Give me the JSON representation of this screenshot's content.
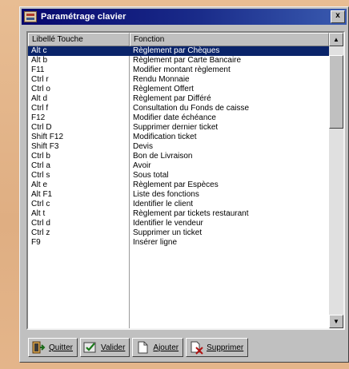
{
  "window": {
    "title": "Paramétrage clavier",
    "close_label": "x"
  },
  "list": {
    "columns": [
      "Libellé Touche",
      "Fonction"
    ],
    "selected_index": 0,
    "rows": [
      {
        "key": "Alt c",
        "function": "Règlement par Chèques"
      },
      {
        "key": "Alt b",
        "function": "Règlement par Carte Bancaire"
      },
      {
        "key": "F11",
        "function": "Modifier montant règlement"
      },
      {
        "key": "Ctrl r",
        "function": "Rendu Monnaie"
      },
      {
        "key": "Ctrl o",
        "function": "Règlement Offert"
      },
      {
        "key": "Alt d",
        "function": "Règlement par Différé"
      },
      {
        "key": "Ctrl f",
        "function": "Consultation du Fonds de caisse"
      },
      {
        "key": "F12",
        "function": "Modifier date échéance"
      },
      {
        "key": "Ctrl D",
        "function": "Supprimer dernier ticket"
      },
      {
        "key": "Shift F12",
        "function": "Modification ticket"
      },
      {
        "key": "Shift F3",
        "function": "Devis"
      },
      {
        "key": "Ctrl b",
        "function": "Bon de Livraison"
      },
      {
        "key": "Ctrl a",
        "function": "Avoir"
      },
      {
        "key": "Ctrl s",
        "function": "Sous total"
      },
      {
        "key": "Alt e",
        "function": "Règlement par Espèces"
      },
      {
        "key": "Alt F1",
        "function": "Liste des fonctions"
      },
      {
        "key": "Ctrl c",
        "function": "Identifier le client"
      },
      {
        "key": "Alt t",
        "function": "Règlement par tickets restaurant"
      },
      {
        "key": "Ctrl d",
        "function": "Identifier le vendeur"
      },
      {
        "key": "Ctrl z",
        "function": "Supprimer un ticket"
      },
      {
        "key": "F9",
        "function": "Insérer ligne"
      }
    ]
  },
  "toolbar": {
    "quit_label": "Quitter",
    "validate_label": "Valider",
    "add_label": "Ajouter",
    "delete_label": "Supprimer"
  },
  "colors": {
    "selection": "#0a246a",
    "titlebar": "#07076e",
    "face": "#c0c0c0"
  }
}
